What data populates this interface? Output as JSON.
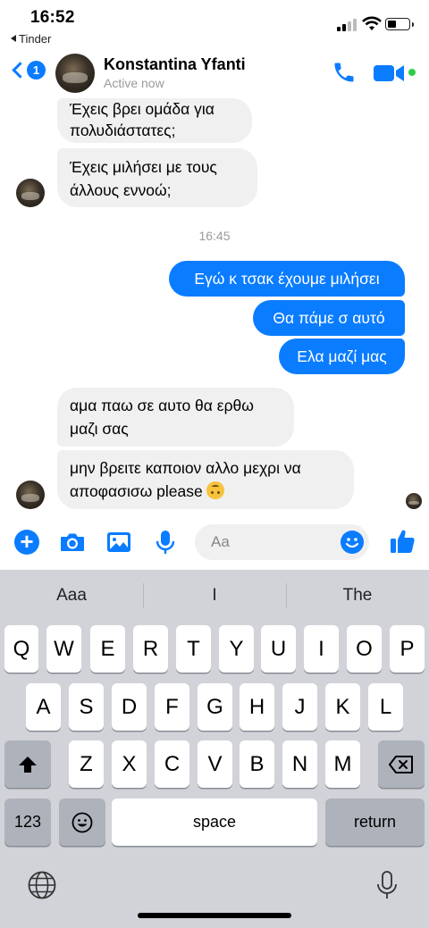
{
  "status_bar": {
    "time": "16:52",
    "back_app": "Tinder"
  },
  "header": {
    "unread_count": "1",
    "contact_name": "Konstantina Yfanti",
    "contact_status": "Active now",
    "accent_color": "#0a7cff",
    "online_color": "#31cc46"
  },
  "messages": [
    {
      "from": "them",
      "text": "Έχεις βρει ομάδα για πολυδιάστατες;"
    },
    {
      "from": "them",
      "text": "Έχεις μιλήσει με τους άλλους εννοώ;"
    },
    {
      "timestamp": "16:45"
    },
    {
      "from": "me",
      "text": "Εγώ κ τσακ έχουμε μιλήσει"
    },
    {
      "from": "me",
      "text": "Θα πάμε σ αυτό"
    },
    {
      "from": "me",
      "text": "Ελα μαζί μας"
    },
    {
      "from": "them",
      "text": "αμα παω σε αυτο θα ερθω μαζι σας"
    },
    {
      "from": "them",
      "text": "μην βρειτε καποιον αλλο μεχρι να αποφασισω please",
      "emoji": "upside-down-face"
    }
  ],
  "composer": {
    "placeholder": "Aa"
  },
  "keyboard": {
    "predictions": [
      "Aaa",
      "I",
      "The"
    ],
    "row1": [
      "Q",
      "W",
      "E",
      "R",
      "T",
      "Y",
      "U",
      "I",
      "O",
      "P"
    ],
    "row2": [
      "A",
      "S",
      "D",
      "F",
      "G",
      "H",
      "J",
      "K",
      "L"
    ],
    "row3": [
      "Z",
      "X",
      "C",
      "V",
      "B",
      "N",
      "M"
    ],
    "numbers_key": "123",
    "space_key": "space",
    "return_key": "return"
  }
}
